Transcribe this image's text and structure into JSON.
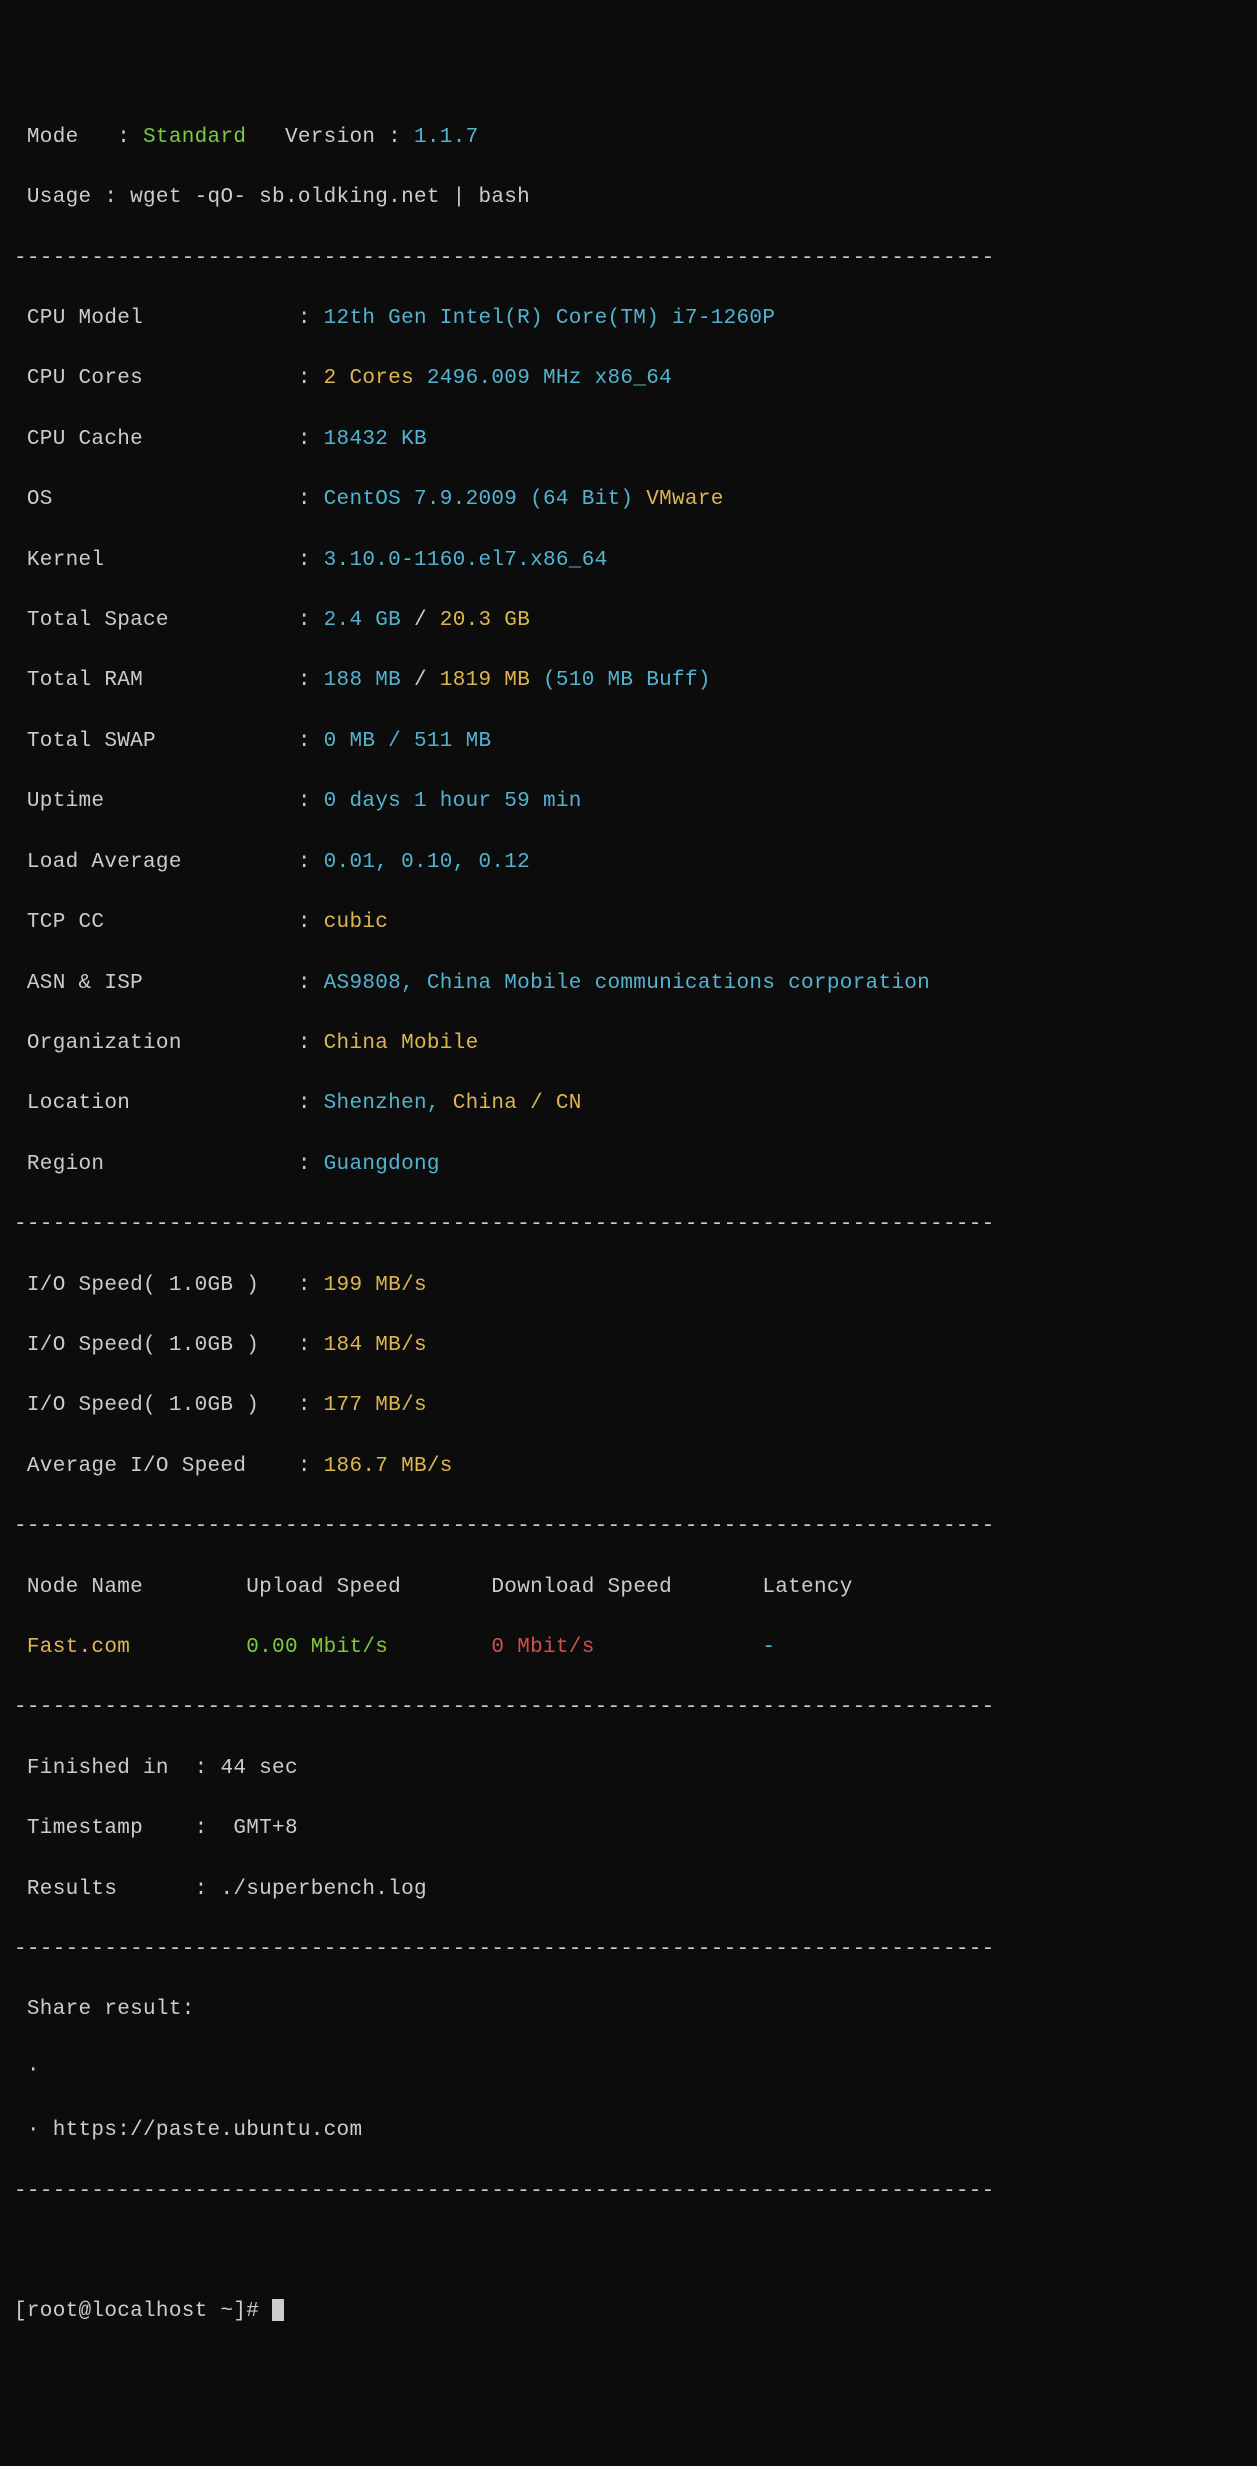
{
  "header": {
    "mode_label": " Mode   : ",
    "mode_value": "Standard",
    "version_label": "   Version : ",
    "version_value": "1.1.7",
    "usage_label": " Usage : ",
    "usage_cmd": "wget -qO- sb.oldking.net | bash"
  },
  "divider": "----------------------------------------------------------------------------",
  "sys": {
    "cpu_model_label": " CPU Model            : ",
    "cpu_model_value": "12th Gen Intel(R) Core(TM) i7-1260P",
    "cpu_cores_label": " CPU Cores            : ",
    "cpu_cores_count": "2 Cores ",
    "cpu_cores_freq": "2496.009 MHz x86_64",
    "cpu_cache_label": " CPU Cache            : ",
    "cpu_cache_value": "18432 KB",
    "os_label": " OS                   : ",
    "os_value": "CentOS 7.9.2009 (64 Bit) ",
    "os_virt": "VMware",
    "kernel_label": " Kernel               : ",
    "kernel_value": "3.10.0-1160.el7.x86_64",
    "space_label": " Total Space          : ",
    "space_used": "2.4 GB ",
    "space_sep": "/ ",
    "space_total": "20.3 GB",
    "ram_label": " Total RAM            : ",
    "ram_used": "188 MB ",
    "ram_sep": "/ ",
    "ram_total": "1819 MB ",
    "ram_buff": "(510 MB Buff)",
    "swap_label": " Total SWAP           : ",
    "swap_value": "0 MB / 511 MB",
    "uptime_label": " Uptime               : ",
    "uptime_value": "0 days 1 hour 59 min",
    "load_label": " Load Average         : ",
    "load_value": "0.01, 0.10, 0.12",
    "tcp_label": " TCP CC               : ",
    "tcp_value": "cubic",
    "asn_label": " ASN & ISP            : ",
    "asn_value": "AS9808, China Mobile communications corporation",
    "org_label": " Organization         : ",
    "org_value": "China Mobile",
    "loc_label": " Location             : ",
    "loc_city": "Shenzhen, ",
    "loc_country": "China / CN",
    "region_label": " Region               : ",
    "region_value": "Guangdong"
  },
  "io": {
    "t1_label": " I/O Speed( 1.0GB )   : ",
    "t1_value": "199 MB/s",
    "t2_label": " I/O Speed( 1.0GB )   : ",
    "t2_value": "184 MB/s",
    "t3_label": " I/O Speed( 1.0GB )   : ",
    "t3_value": "177 MB/s",
    "avg_label": " Average I/O Speed    : ",
    "avg_value": "186.7 MB/s"
  },
  "net": {
    "hdr_node": " Node Name        ",
    "hdr_up": "Upload Speed       ",
    "hdr_down": "Download Speed     ",
    "hdr_lat": "  Latency",
    "row_node": " Fast.com         ",
    "row_up": "0.00 Mbit/s        ",
    "row_down": "0 Mbit/s           ",
    "row_lat": "  -  "
  },
  "footer": {
    "finished_label": " Finished in  : ",
    "finished_value": "44 sec",
    "ts_label": " Timestamp    : ",
    "ts_value": " GMT+8",
    "results_label": " Results      : ",
    "results_value": "./superbench.log",
    "share_label": " Share result:",
    "bullet": " ·",
    "share_url": " · https://paste.ubuntu.com",
    "prompt": "[root@localhost ~]# "
  }
}
